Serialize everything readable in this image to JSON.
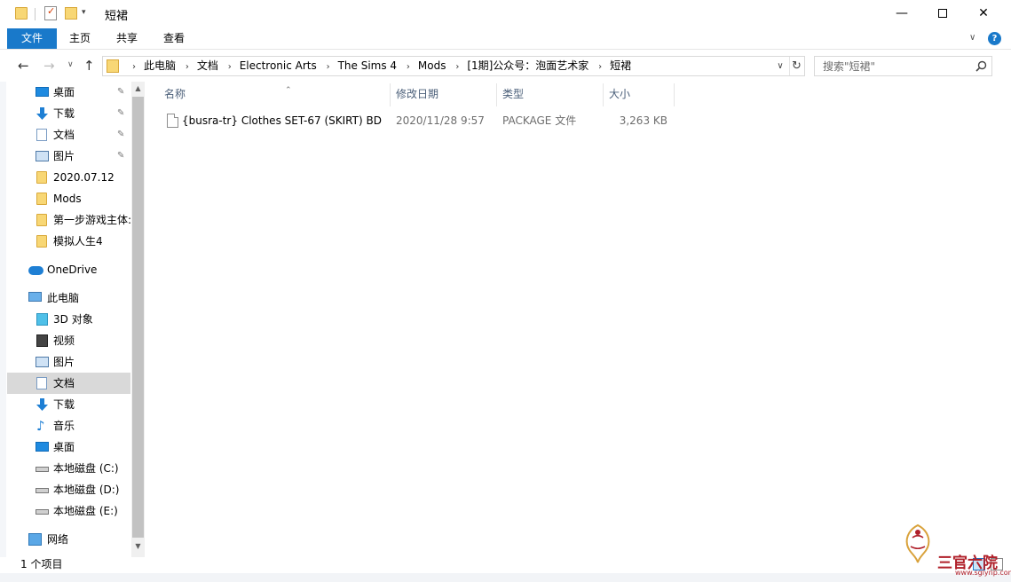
{
  "window": {
    "title": "短裙",
    "controls": {
      "minimize": "—",
      "close": "✕"
    }
  },
  "ribbon": {
    "tabs": [
      "文件",
      "主页",
      "共享",
      "查看"
    ],
    "help": "?"
  },
  "address": {
    "crumbs": [
      "此电脑",
      "文档",
      "Electronic Arts",
      "The Sims 4",
      "Mods",
      "[1期]公众号：泡面艺术家",
      "短裙"
    ]
  },
  "search": {
    "placeholder": "搜索\"短裙\""
  },
  "sidebar": {
    "items": [
      {
        "label": "桌面",
        "icon": "desktop-icon",
        "pinned": true
      },
      {
        "label": "下载",
        "icon": "download-icon",
        "pinned": true
      },
      {
        "label": "文档",
        "icon": "document-icon",
        "pinned": true
      },
      {
        "label": "图片",
        "icon": "pictures-icon",
        "pinned": true
      },
      {
        "label": "2020.07.12",
        "icon": "folder-icon"
      },
      {
        "label": "Mods",
        "icon": "folder-icon"
      },
      {
        "label": "第一步游戏主体:",
        "icon": "folder-icon"
      },
      {
        "label": "模拟人生4",
        "icon": "folder-icon"
      },
      {
        "label": "OneDrive",
        "icon": "onedrive-icon"
      },
      {
        "label": "此电脑",
        "icon": "this-pc-icon"
      },
      {
        "label": "3D 对象",
        "icon": "3d-objects-icon"
      },
      {
        "label": "视频",
        "icon": "videos-icon"
      },
      {
        "label": "图片",
        "icon": "pictures-icon"
      },
      {
        "label": "文档",
        "icon": "document-icon",
        "selected": true
      },
      {
        "label": "下载",
        "icon": "download-icon"
      },
      {
        "label": "音乐",
        "icon": "music-icon"
      },
      {
        "label": "桌面",
        "icon": "desktop-icon"
      },
      {
        "label": "本地磁盘 (C:)",
        "icon": "drive-c-icon"
      },
      {
        "label": "本地磁盘 (D:)",
        "icon": "drive-icon"
      },
      {
        "label": "本地磁盘 (E:)",
        "icon": "drive-icon"
      },
      {
        "label": "网络",
        "icon": "network-icon"
      }
    ]
  },
  "table": {
    "columns": [
      "名称",
      "修改日期",
      "类型",
      "大小"
    ],
    "rows": [
      {
        "name": "{busra-tr} Clothes SET-67 (SKIRT) BD...",
        "date": "2020/11/28 9:57",
        "type": "PACKAGE 文件",
        "size": "3,263 KB"
      }
    ]
  },
  "status": {
    "count": "1 个项目"
  },
  "watermark": {
    "brand": "三官六院",
    "url": "www.sglynp.com"
  },
  "colors": {
    "accent": "#1979ca",
    "folder": "#f8d775",
    "selected": "#d9d9d9"
  }
}
